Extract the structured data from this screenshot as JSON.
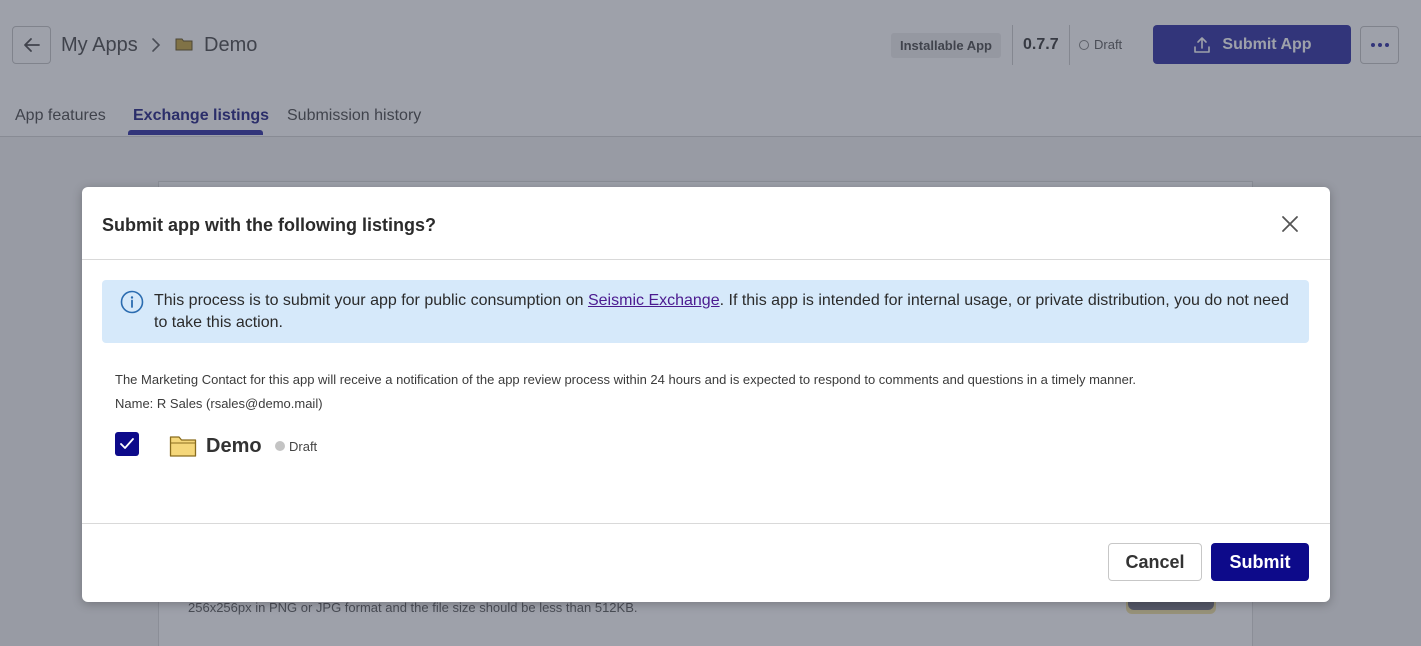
{
  "colors": {
    "primary": "#0d0a8a",
    "submit_app_bg": "#3b3ba8",
    "info_bg": "#d6e9fa",
    "info_icon": "#2b6cb0",
    "draft_dot": "#c4c4c4",
    "folder_fill": "#f5d77a",
    "folder_stroke": "#8a6d1e"
  },
  "header": {
    "breadcrumb": {
      "parent": "My Apps",
      "current": "Demo"
    },
    "app_type": "Installable App",
    "version": "0.7.7",
    "status": "Draft",
    "submit_app_label": "Submit App",
    "icons": {
      "back": "arrow-left-icon",
      "folder": "folder-icon",
      "upload": "upload-icon",
      "more": "more-horizontal-icon",
      "chevron": "chevron-right-icon"
    }
  },
  "tabs": [
    {
      "label": "App features",
      "active": false
    },
    {
      "label": "Exchange listings",
      "active": true
    },
    {
      "label": "Submission history",
      "active": false
    }
  ],
  "background_card": {
    "hint": "256x256px in PNG or JPG format and the file size should be less than 512KB."
  },
  "modal": {
    "title": "Submit app with the following listings?",
    "close_icon": "close-icon",
    "info": {
      "icon": "info-icon",
      "text_before": "This process is to submit your app for public consumption on ",
      "link_text": "Seismic Exchange",
      "text_after": ". If this app is intended for internal usage, or private distribution, you do not need to take this action."
    },
    "notice": "The Marketing Contact for this app will receive a notification of the app review process within 24 hours and is expected to respond to comments and questions in a timely manner.",
    "contact": "Name: R Sales (rsales@demo.mail)",
    "listing": {
      "checked": true,
      "name": "Demo",
      "status": "Draft"
    },
    "cancel_label": "Cancel",
    "submit_label": "Submit"
  }
}
